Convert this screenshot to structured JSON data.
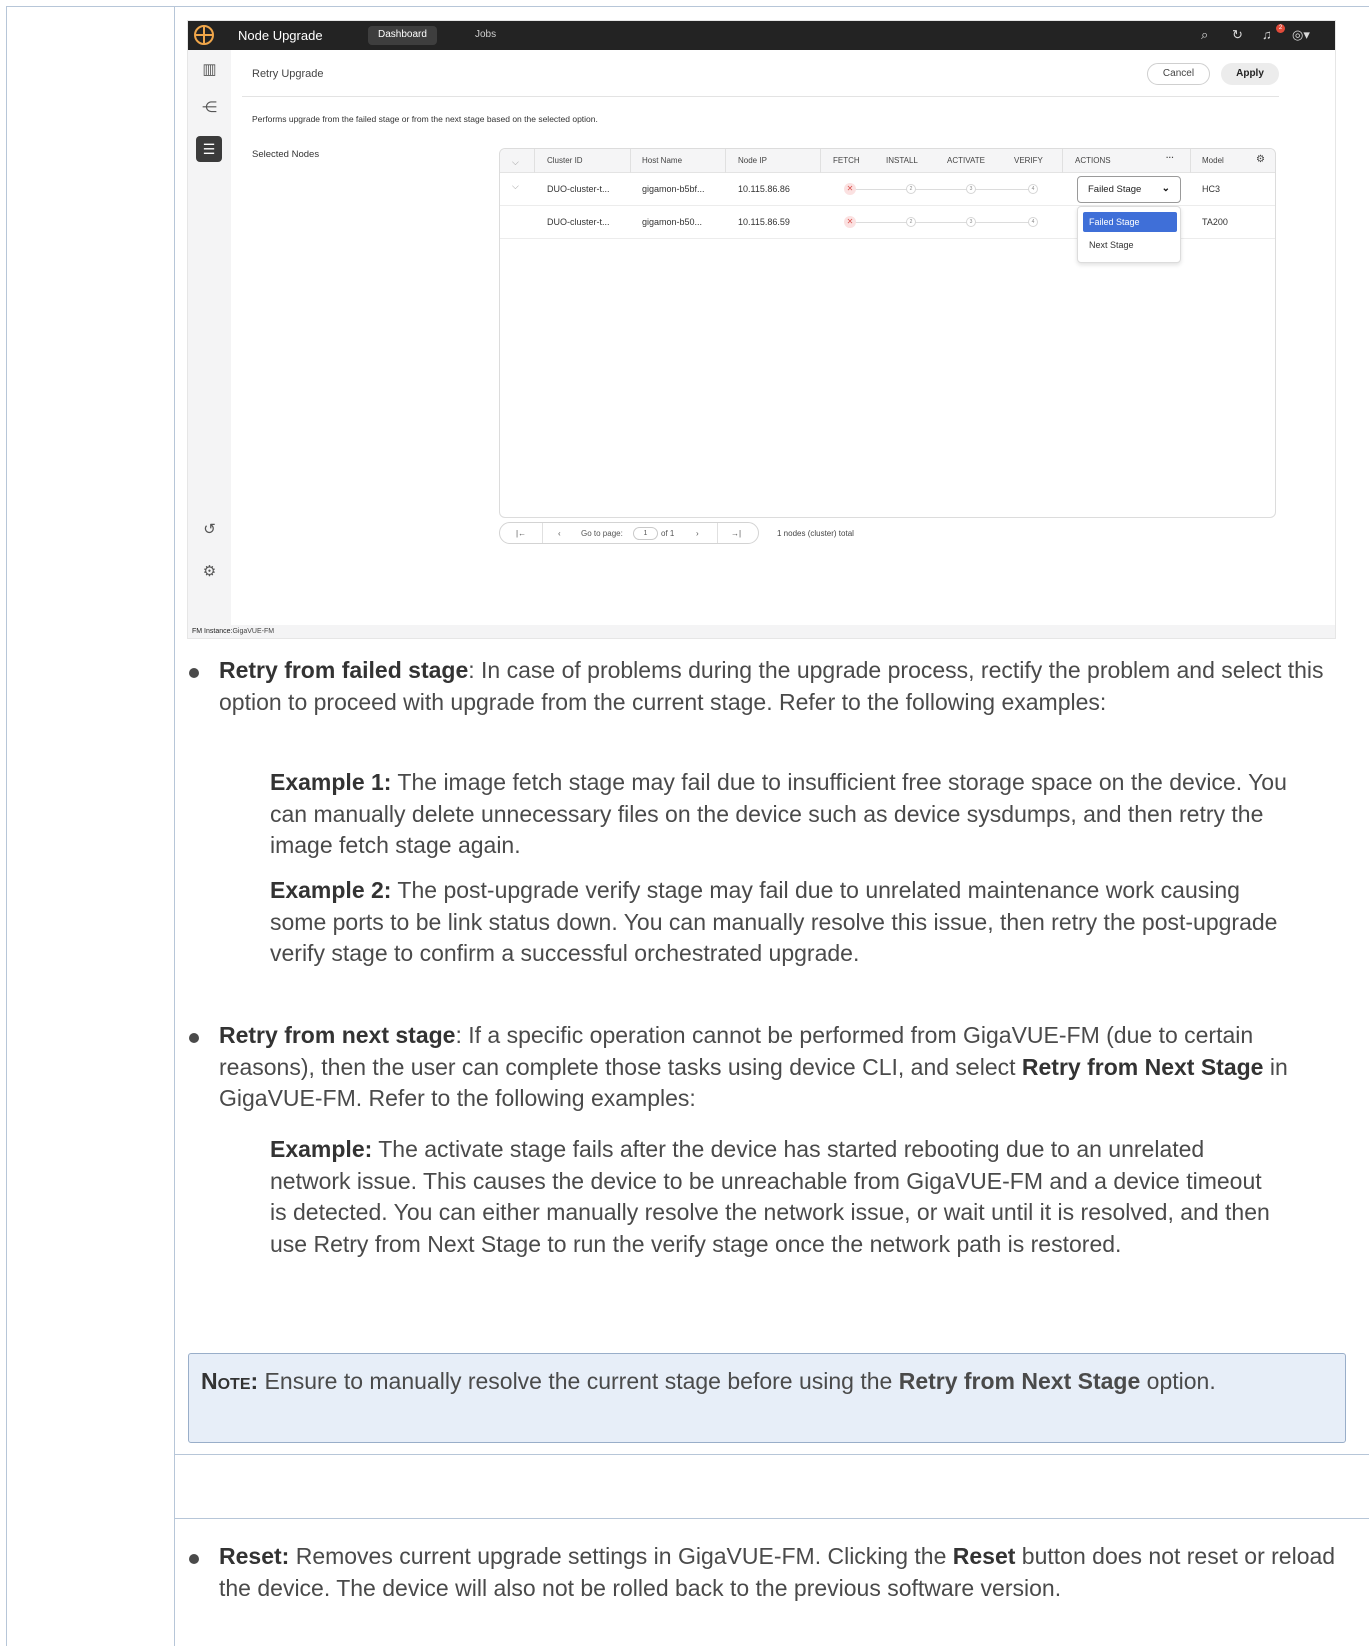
{
  "screenshot": {
    "topbar": {
      "app_title": "Node Upgrade",
      "tab_dashboard": "Dashboard",
      "tab_jobs": "Jobs",
      "notification_count": "2"
    },
    "breadcrumb": "Retry Upgrade",
    "cancel_label": "Cancel",
    "apply_label": "Apply",
    "description": "Performs upgrade from the failed stage or from the next stage based on the selected option.",
    "selected_nodes_label": "Selected Nodes",
    "columns": [
      "Cluster ID",
      "Host Name",
      "Node IP",
      "FETCH",
      "INSTALL",
      "ACTIVATE",
      "VERIFY",
      "ACTIONS",
      "Model"
    ],
    "rows": [
      {
        "cluster_id": "DUO-cluster-t...",
        "host_name": "gigamon-b5bf...",
        "node_ip": "10.115.86.86",
        "stages": [
          "2",
          "3",
          "4"
        ],
        "model": "HC3"
      },
      {
        "cluster_id": "DUO-cluster-t...",
        "host_name": "gigamon-b50...",
        "node_ip": "10.115.86.59",
        "stages": [
          "2",
          "3",
          "4"
        ],
        "model": "TA200"
      }
    ],
    "action_select_value": "Failed Stage",
    "dropdown_options": [
      "Failed Stage",
      "Next Stage"
    ],
    "pager": {
      "go_to_page": "Go to page:",
      "page": "1",
      "of": "of 1",
      "total": "1 nodes (cluster) total"
    },
    "footer_label": "FM Instance:",
    "footer_value": "GigaVUE-FM"
  },
  "doc": {
    "bullet1_term": "Retry from failed stage",
    "bullet1_text": ": In case of problems during the upgrade process, rectify the problem and select this option to proceed with upgrade from the current stage. Refer to the following examples:",
    "ex1_label": "Example 1:",
    "ex1_text": " The image fetch stage may fail due to insufficient free storage space on the device. You can manually delete unnecessary files on the device such as device sysdumps, and then retry the image fetch stage again.",
    "ex2_label": "Example 2:",
    "ex2_text": " The post-upgrade verify stage may fail due to unrelated maintenance work causing some ports to be link status down. You can manually resolve this issue, then retry the post-upgrade verify stage to confirm a successful orchestrated upgrade.",
    "bullet2_term": "Retry from next stage",
    "bullet2_text_a": ": If a specific operation cannot be performed from GigaVUE-FM (due to certain reasons), then the user can complete those tasks using device CLI, and select ",
    "bullet2_bold": "Retry from Next Stage",
    "bullet2_text_b": " in GigaVUE-FM. Refer to the following examples:",
    "ex3_label": "Example:",
    "ex3_text": " The activate stage fails after the device has started rebooting due to an unrelated network issue. This causes the device to be unreachable from GigaVUE-FM and a device timeout is detected. You can either manually resolve the network issue, or wait until it is resolved, and then use Retry from Next Stage to run the verify stage once the network path is restored.",
    "note_label": "Note:",
    "note_text_a": " Ensure to manually resolve the current stage before using the ",
    "note_bold": "Retry from Next Stage",
    "note_text_b": " option.",
    "bullet3_term": "Reset:",
    "bullet3_text_a": " Removes current upgrade settings in GigaVUE-FM. Clicking the ",
    "bullet3_bold": "Reset",
    "bullet3_text_b": " button does not reset or reload the device. The device will also not be rolled back to the previous software version."
  }
}
